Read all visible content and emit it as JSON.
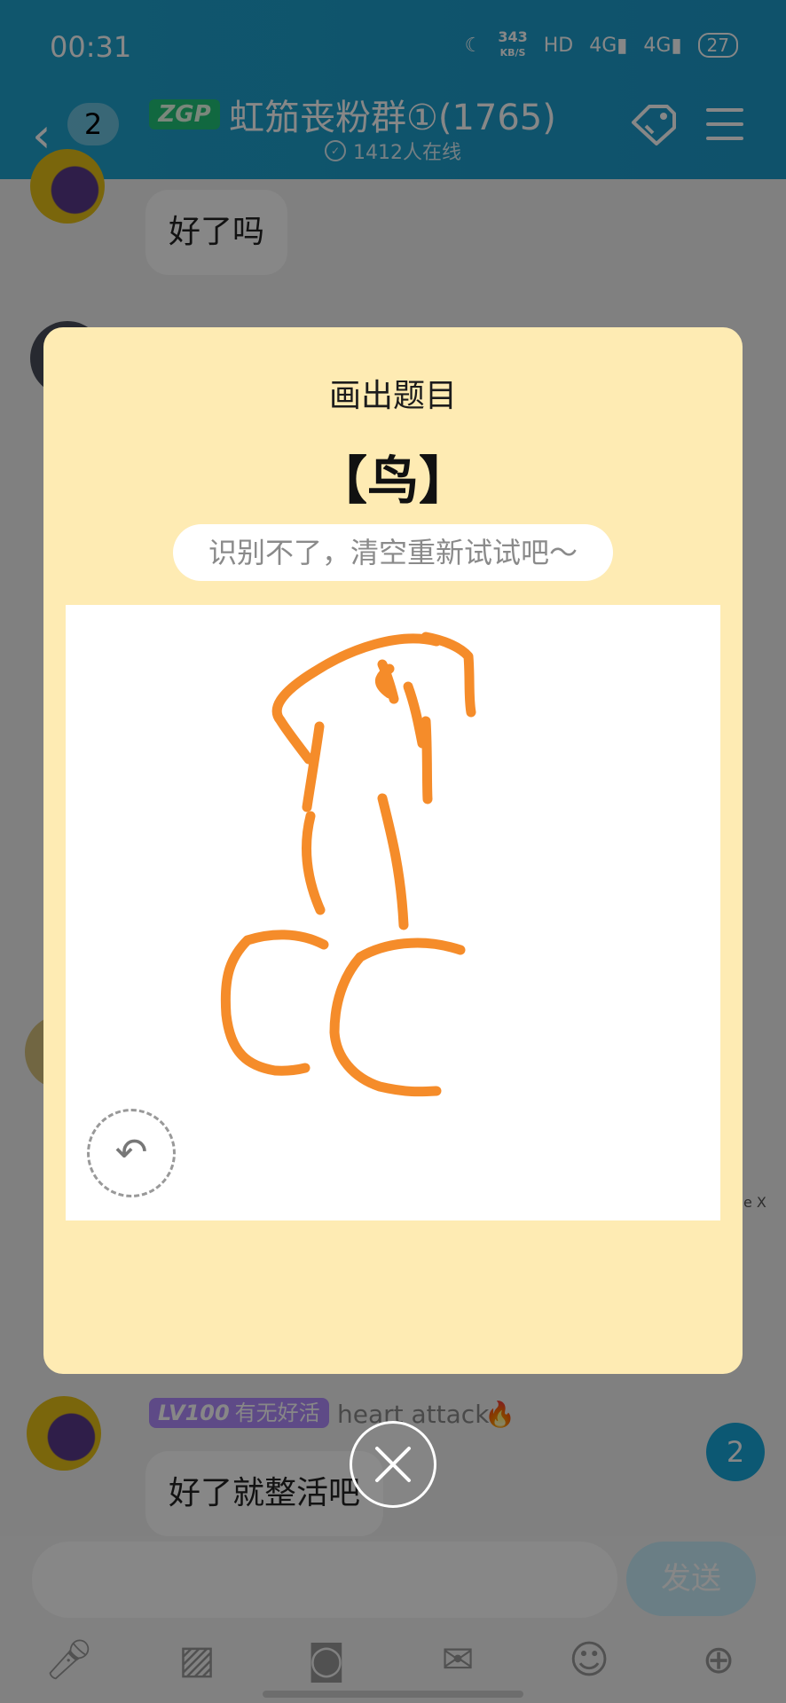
{
  "status_bar": {
    "time": "00:31",
    "speed_value": "343",
    "speed_unit": "KB/S",
    "hd_label": "HD",
    "network_1": "4G",
    "network_2": "4G",
    "battery": "27"
  },
  "header": {
    "unread_count": "2",
    "level_badge": "ZGP",
    "title": "虹笳丧粉群①(1765)",
    "online_text": "1412人在线"
  },
  "chat": {
    "messages": [
      {
        "text": "好了吗"
      },
      {
        "badge_level": "LV100",
        "badge_title": "有无好活",
        "sender": "heart attack",
        "text": "好了就整活吧"
      }
    ],
    "floating_badge": "2",
    "side_mark": "e X"
  },
  "input_bar": {
    "placeholder": "",
    "send_label": "发送"
  },
  "modal": {
    "title": "画出题目",
    "subject": "【鸟】",
    "hint": "识别不了，清空重新试试吧～",
    "stroke_color": "#f58c2a",
    "background_color": "#feebb3"
  },
  "colors": {
    "header": "#1fa3cf",
    "overlay": "#000000",
    "lv_badge": "#b28cff",
    "float_badge": "#17a7d9"
  }
}
